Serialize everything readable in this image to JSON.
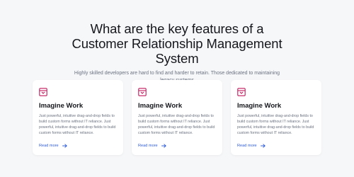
{
  "header": {
    "title": "What are the key features of a Customer Relationship Management System",
    "subtitle": "Highly skilled developers are hard to find and harder to retain. Those dedicated to maintaining legacy systems"
  },
  "colors": {
    "accent": "#c2185b",
    "link": "#2d5bd6",
    "background": "#f6f7f9"
  },
  "cards": [
    {
      "icon": "archive-box-icon",
      "title": "Imagine Work",
      "description": "Just powerful, intuitive drag-and-drop fields to build custom forms without IT reliance. Just powerful, intuitive drag-and-drop fields to build custom forms without IT reliance.",
      "link_label": "Read more"
    },
    {
      "icon": "archive-box-icon",
      "title": "Imagine Work",
      "description": "Just powerful, intuitive drag-and-drop fields to build custom forms without IT reliance. Just powerful, intuitive drag-and-drop fields to build custom forms without IT reliance.",
      "link_label": "Read more"
    },
    {
      "icon": "archive-box-icon",
      "title": "Imagine Work",
      "description": "Just powerful, intuitive drag-and-drop fields to build custom forms without IT reliance. Just powerful, intuitive drag-and-drop fields to build custom forms without IT reliance.",
      "link_label": "Read more"
    }
  ]
}
